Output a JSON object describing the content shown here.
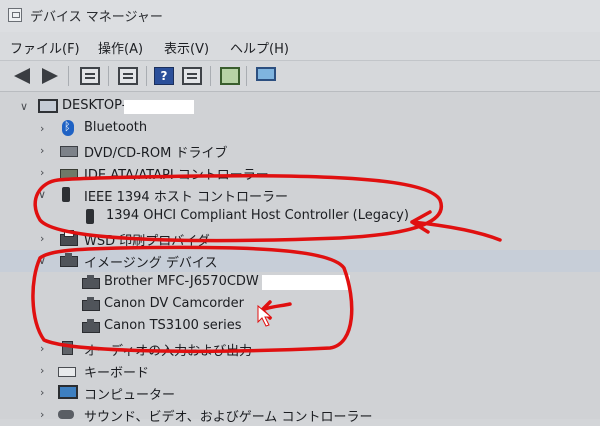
{
  "window": {
    "title": "デバイス マネージャー"
  },
  "menu": [
    "ファイル(F)",
    "操作(A)",
    "表示(V)",
    "ヘルプ(H)"
  ],
  "toolbar": [
    "back-icon",
    "forward-icon",
    "properties-icon",
    "list-icon",
    "help-icon",
    "view-icon",
    "scan-hardware-icon",
    "monitor-icon"
  ],
  "tree": {
    "root": "DESKTOP-",
    "items": [
      {
        "label": "Bluetooth",
        "icon": "bluetooth-icon",
        "expanded": false
      },
      {
        "label": "DVD/CD-ROM ドライブ",
        "icon": "dvd-drive-icon",
        "expanded": false
      },
      {
        "label": "IDE ATA/ATAPI コントローラー",
        "icon": "ide-controller-icon",
        "expanded": false
      },
      {
        "label": "IEEE 1394 ホスト コントローラー",
        "icon": "firewire-icon",
        "expanded": true,
        "children": [
          {
            "label": "1394 OHCI Compliant Host Controller (Legacy)",
            "icon": "firewire-icon"
          }
        ]
      },
      {
        "label": "WSD 印刷プロバイダー",
        "icon": "printer-icon",
        "expanded": false
      },
      {
        "label": "イメージング デバイス",
        "icon": "imaging-device-icon",
        "expanded": true,
        "children": [
          {
            "label": "Brother MFC-J6570CDW",
            "icon": "imaging-device-icon"
          },
          {
            "label": "Canon DV Camcorder",
            "icon": "imaging-device-icon"
          },
          {
            "label": "Canon TS3100 series",
            "icon": "imaging-device-icon"
          }
        ]
      },
      {
        "label": "オーディオの入力および出力",
        "icon": "audio-icon",
        "expanded": false
      },
      {
        "label": "キーボード",
        "icon": "keyboard-icon",
        "expanded": false
      },
      {
        "label": "コンピューター",
        "icon": "computer-icon",
        "expanded": false
      },
      {
        "label": "サウンド、ビデオ、およびゲーム コントローラー",
        "icon": "game-controller-icon",
        "expanded": false
      }
    ]
  },
  "colors": {
    "annotation": "#e01010",
    "background": "#d0d2d5"
  }
}
